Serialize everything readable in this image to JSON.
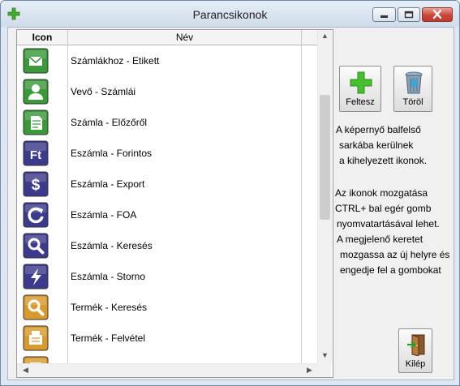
{
  "window": {
    "title": "Parancsikonok"
  },
  "grid": {
    "columns": {
      "icon": "Icon",
      "name": "Név"
    },
    "rows": [
      {
        "label": "Számlákhoz - Etikett",
        "icon": "envelope-icon",
        "color": "#3a9a3a"
      },
      {
        "label": "Vevő - Számlái",
        "icon": "person-icon",
        "color": "#3a9a3a"
      },
      {
        "label": "Számla - Előzőről",
        "icon": "document-icon",
        "color": "#3a9a3a"
      },
      {
        "label": "Eszámla - Forintos",
        "icon": "ft-icon",
        "color": "#3c3a8c",
        "glyph": "Ft"
      },
      {
        "label": "Eszámla - Export",
        "icon": "dollar-icon",
        "color": "#3c3a8c",
        "glyph": "$"
      },
      {
        "label": "Eszámla - FOA",
        "icon": "refresh-icon",
        "color": "#3c3a8c"
      },
      {
        "label": "Eszámla - Keresés",
        "icon": "magnifier-icon",
        "color": "#3c3a8c"
      },
      {
        "label": "Eszámla - Storno",
        "icon": "lightning-icon",
        "color": "#3c3a8c"
      },
      {
        "label": "Termék - Keresés",
        "icon": "magnifier-icon",
        "color": "#d89a2c"
      },
      {
        "label": "Termék - Felvétel",
        "icon": "register-icon",
        "color": "#d89a2c"
      },
      {
        "label": "",
        "icon": "list-icon",
        "color": "#d89a2c"
      }
    ]
  },
  "buttons": {
    "add": "Feltesz",
    "delete": "Töröl",
    "exit": "Kilép"
  },
  "info": {
    "block1": [
      "A képernyő balfelső",
      "sarkába kerülnek",
      "a kihelyezett ikonok."
    ],
    "block2": [
      "Az ikonok mozgatása",
      "CTRL+ bal egér gomb",
      "nyomvatartásával lehet.",
      "A megjelenő keretet",
      "mozgassa az új helyre és",
      "engedje fel a gombokat"
    ]
  }
}
